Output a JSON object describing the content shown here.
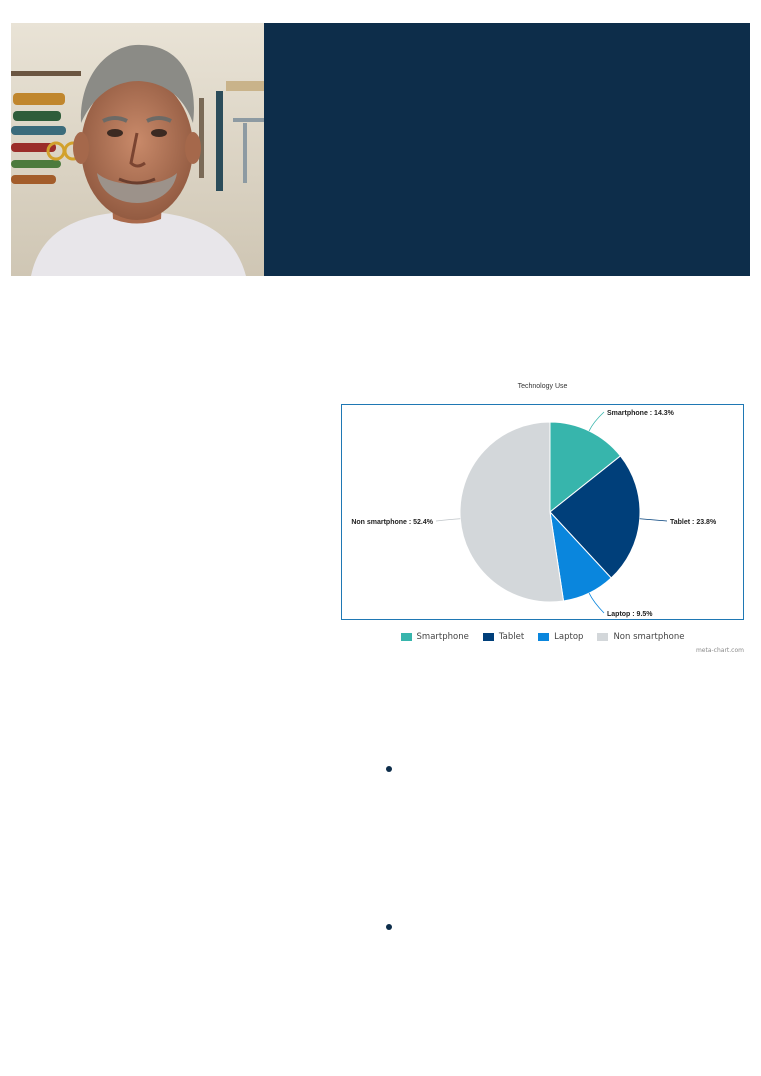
{
  "hero": {
    "photo_alt": "Older man in a white t-shirt in a workshop with tools on the wall",
    "panel_color": "#0d2d4a"
  },
  "chart_data": {
    "type": "pie",
    "title": "Technology Use",
    "slices": [
      {
        "label": "Smartphone",
        "value": 14.3,
        "color": "#37b5ac",
        "text": "Smartphone : 14.3%"
      },
      {
        "label": "Tablet",
        "value": 23.8,
        "color": "#003f7a",
        "text": "Tablet : 23.8%"
      },
      {
        "label": "Laptop",
        "value": 9.5,
        "color": "#0a86dd",
        "text": "Laptop : 9.5%"
      },
      {
        "label": "Non smartphone",
        "value": 52.4,
        "color": "#d3d7da",
        "text": "Non smartphone : 52.4%"
      }
    ],
    "legend": [
      "Smartphone",
      "Tablet",
      "Laptop",
      "Non smartphone"
    ],
    "legend_placement": "bottom",
    "credit": "meta-chart.com"
  },
  "bullets": {
    "count": 2,
    "color": "#0d2d4a"
  }
}
